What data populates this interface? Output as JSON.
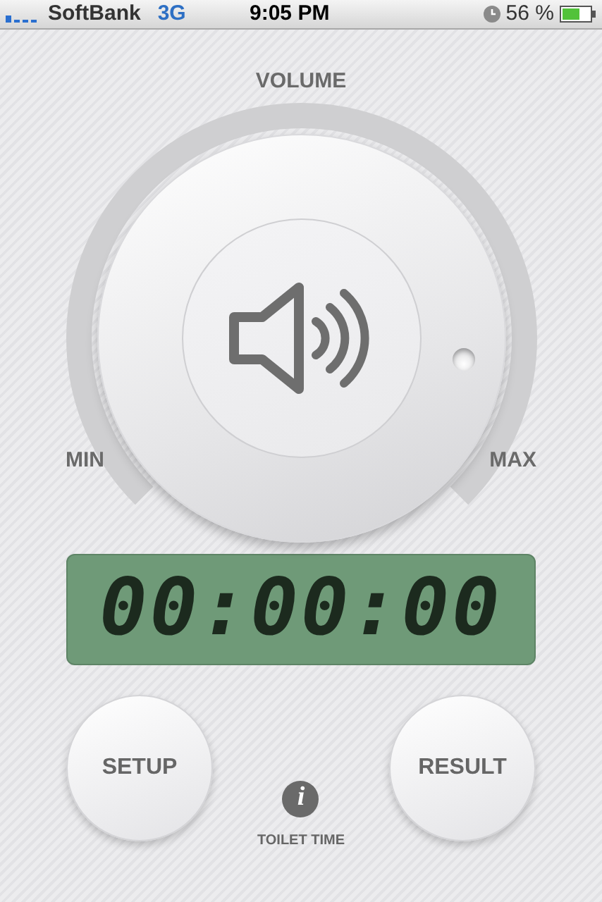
{
  "status_bar": {
    "carrier": "SoftBank",
    "network": "3G",
    "time": "9:05 PM",
    "battery": "56 %"
  },
  "volume": {
    "label": "VOLUME",
    "min_label": "MIN",
    "max_label": "MAX"
  },
  "timer": {
    "display": "00:00:00"
  },
  "buttons": [
    {
      "label": "SETUP"
    },
    {
      "label": "RESULT"
    }
  ],
  "info": {
    "glyph": "i",
    "caption": "TOILET TIME"
  }
}
